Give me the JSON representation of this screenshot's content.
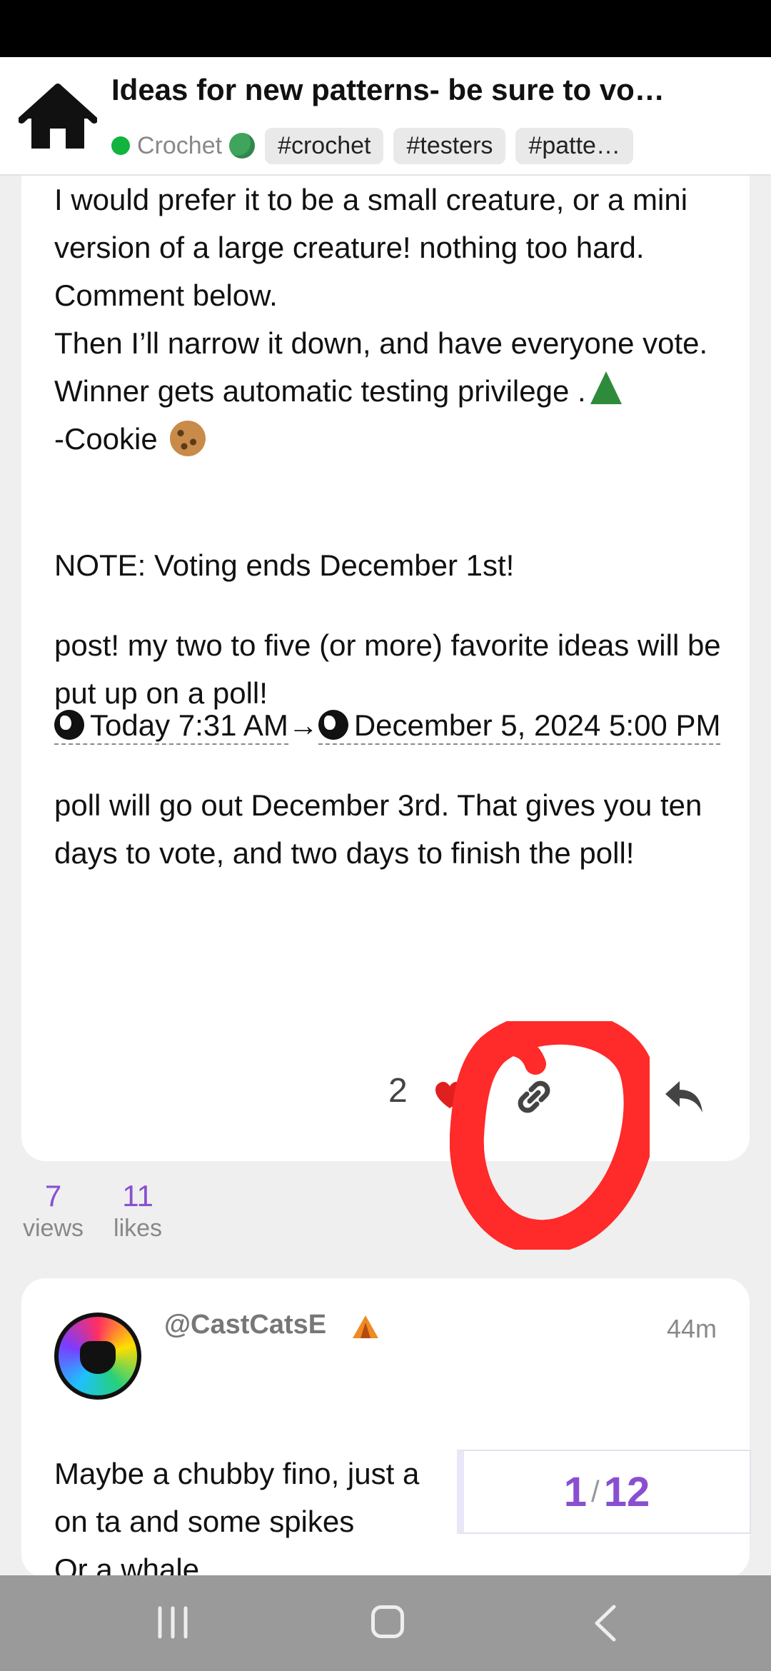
{
  "header": {
    "title": "Ideas for new patterns- be sure to vo…",
    "category": "Crochet",
    "tags": [
      "#crochet",
      "#testers",
      "#patte…"
    ]
  },
  "post1": {
    "para1": "I would prefer it to be a small creature, or a mini version of a large creature! nothing too hard. Comment below.",
    "para1b": "Then I’ll narrow it down, and have everyone vote. Winner gets automatic testing privilege .",
    "signature": "-Cookie",
    "note": "NOTE: Voting ends December 1st!",
    "para2": "post! my two to five (or more) favorite ideas will be put up on a poll!",
    "date_start": "Today 7:31 AM",
    "arrow": "→",
    "date_end": "December 5, 2024 5:00 PM",
    "para3": "poll will go out December 3rd. That gives you ten days to vote, and two days to finish the poll!",
    "like_count": "2"
  },
  "stats": {
    "views_num": "7",
    "views_label": "views",
    "likes_num": "11",
    "likes_label": "likes"
  },
  "post2": {
    "username": "@CastCatsE",
    "time": "44m",
    "line1": "Maybe a chubby fino, just a",
    "line2": "on ta and some spikes",
    "line3": "Or a whale"
  },
  "progress": {
    "current": "1",
    "separator": "/",
    "total": "12"
  },
  "colors": {
    "accent": "#8a4fd1",
    "annotation": "#ff2a2a",
    "category_dot": "#12b33e"
  }
}
